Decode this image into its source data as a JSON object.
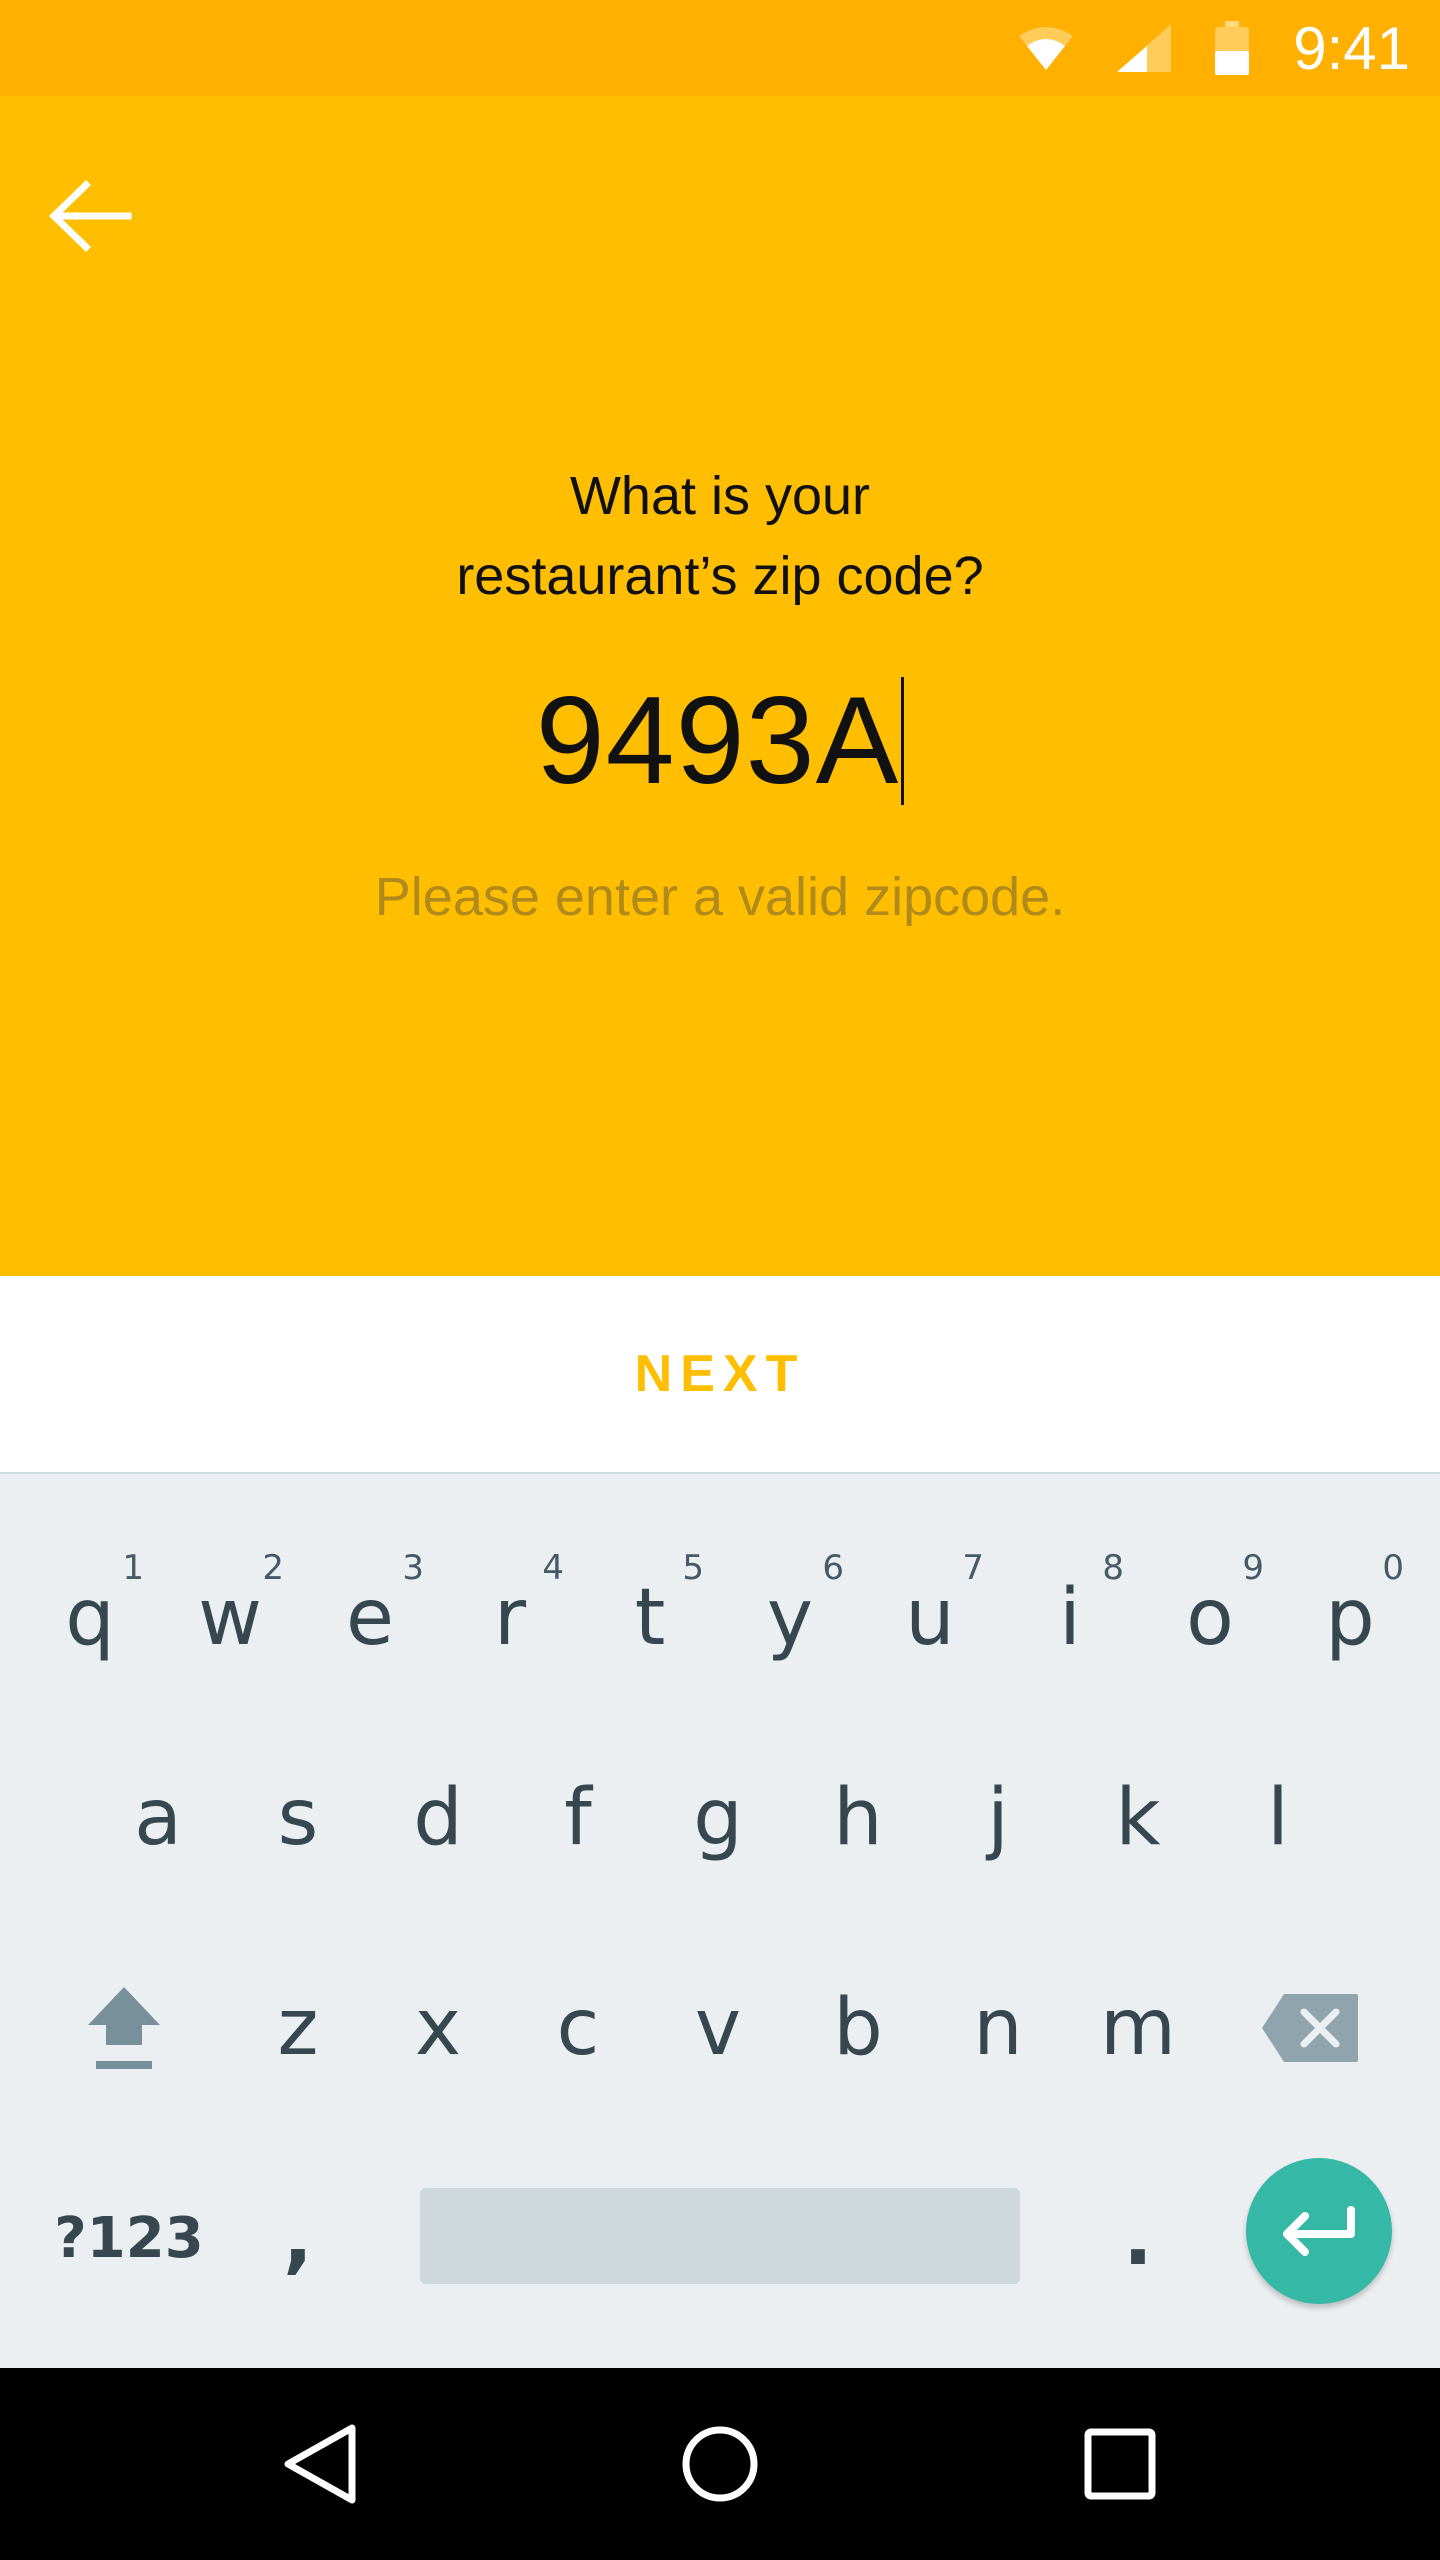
{
  "status_bar": {
    "time": "9:41",
    "icons": [
      "wifi-icon",
      "cell-signal-icon",
      "battery-icon"
    ],
    "color": "#FFB000"
  },
  "header": {
    "back_icon": "arrow-back-icon"
  },
  "main": {
    "question_line1": "What is your",
    "question_line2": "restaurant’s zip code?",
    "zip_value": "9493A",
    "error_text": "Please enter a valid zipcode.",
    "background": "#FFBF00"
  },
  "next_button": {
    "label": "NEXT",
    "color": "#FFBF00"
  },
  "keyboard": {
    "row1": [
      {
        "key": "q",
        "hint": "1"
      },
      {
        "key": "w",
        "hint": "2"
      },
      {
        "key": "e",
        "hint": "3"
      },
      {
        "key": "r",
        "hint": "4"
      },
      {
        "key": "t",
        "hint": "5"
      },
      {
        "key": "y",
        "hint": "6"
      },
      {
        "key": "u",
        "hint": "7"
      },
      {
        "key": "i",
        "hint": "8"
      },
      {
        "key": "o",
        "hint": "9"
      },
      {
        "key": "p",
        "hint": "0"
      }
    ],
    "row2": [
      "a",
      "s",
      "d",
      "f",
      "g",
      "h",
      "j",
      "k",
      "l"
    ],
    "row3": [
      "z",
      "x",
      "c",
      "v",
      "b",
      "n",
      "m"
    ],
    "symbols_label": "?123",
    "comma": ",",
    "period": ".",
    "enter_color": "#35B8A6"
  },
  "nav_bar": {
    "icons": [
      "back-triangle-icon",
      "home-circle-icon",
      "recents-square-icon"
    ]
  }
}
